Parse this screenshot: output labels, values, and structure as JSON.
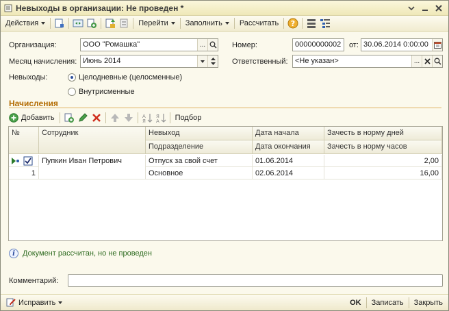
{
  "window": {
    "title": "Невыходы в организации: Не проведен *",
    "icons": [
      "document-icon",
      "menu-icon",
      "minimize-icon",
      "close-icon"
    ]
  },
  "toolbar": {
    "actions_label": "Действия",
    "goto_label": "Перейти",
    "fill_label": "Заполнить",
    "calc_label": "Рассчитать",
    "icons": [
      "post-icon",
      "view-icon",
      "copy-icon",
      "transfer-icon",
      "structure-icon",
      "help-icon",
      "list-icon",
      "tree-icon"
    ]
  },
  "form": {
    "org_label": "Организация:",
    "org_value": "ООО \"Ромашка\"",
    "number_label": "Номер:",
    "number_value": "00000000002",
    "date_from_label": "от:",
    "date_value": "30.06.2014  0:00:00",
    "month_label": "Месяц начисления:",
    "month_value": "Июнь 2014",
    "responsible_label": "Ответственный:",
    "responsible_value": "<Не указан>",
    "absence_label": "Невыходы:",
    "radio_whole_label": "Целодневные (целосменные)",
    "radio_intra_label": "Внутрисменные",
    "radio_selected": "whole"
  },
  "accruals": {
    "section_title": "Начисления",
    "add_label": "Добавить",
    "pick_label": "Подбор",
    "icons": [
      "add-icon",
      "copy-row-icon",
      "edit-icon",
      "delete-icon",
      "move-up-icon",
      "move-down-icon",
      "sort-asc-icon",
      "sort-desc-icon"
    ]
  },
  "grid": {
    "headers": {
      "num": "№",
      "employee": "Сотрудник",
      "absence": "Невыход",
      "department": "Подразделение",
      "date_start": "Дата начала",
      "date_end": "Дата окончания",
      "norm_days": "Зачесть в норму дней",
      "norm_hours": "Зачесть в норму часов"
    },
    "rows": [
      {
        "num": "1",
        "employee": "Пупкин Иван Петрович",
        "absence": "Отпуск за свой счет",
        "department": "Основное",
        "date_start": "01.06.2014",
        "date_end": "02.06.2014",
        "norm_days": "2,00",
        "norm_hours": "16,00"
      }
    ]
  },
  "status": {
    "message": "Документ рассчитан, но не проведен"
  },
  "comment": {
    "label": "Комментарий:",
    "value": ""
  },
  "footer": {
    "fix_label": "Исправить",
    "ok_label": "OK",
    "save_label": "Записать",
    "close_label": "Закрыть"
  }
}
